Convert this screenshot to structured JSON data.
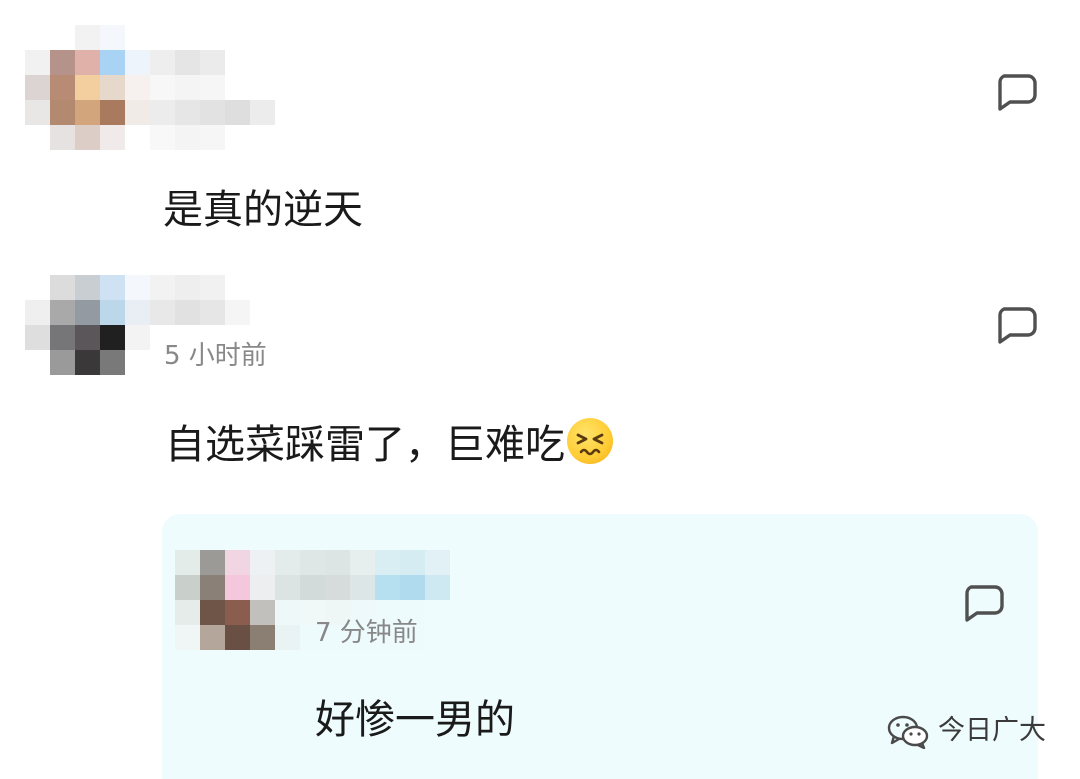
{
  "comments": [
    {
      "text": "是真的逆天",
      "avatar_blur_colors": [
        [
          "#ffffff",
          "#ffffff",
          "#f2f2f2",
          "#f4f8fc",
          "#ffffff",
          "#ffffff",
          "#ffffff",
          "#ffffff",
          "#ffffff",
          "#ffffff",
          "#ffffff"
        ],
        [
          "#f1f1f1",
          "#b5928a",
          "#e0b1a8",
          "#a8d3f5",
          "#eef4fb",
          "#eeeeee",
          "#e5e5e5",
          "#ebebeb",
          "#ffffff",
          "#ffffff",
          "#ffffff"
        ],
        [
          "#dbd4d2",
          "#b78b74",
          "#f3cf9f",
          "#e6d9cc",
          "#f6f1ee",
          "#f7f7f7",
          "#f4f4f4",
          "#f6f6f6",
          "#ffffff",
          "#ffffff",
          "#ffffff"
        ],
        [
          "#e9e6e6",
          "#b3896f",
          "#d3a57d",
          "#a97a5e",
          "#f1ebe8",
          "#ececec",
          "#e6e6e6",
          "#e2e2e2",
          "#dedede",
          "#ececec",
          "#ffffff"
        ],
        [
          "#ffffff",
          "#e6e2e2",
          "#ddcdc7",
          "#f0ebea",
          "#ffffff",
          "#f8f8f8",
          "#f4f4f4",
          "#f6f6f6",
          "#ffffff",
          "#ffffff",
          "#ffffff"
        ]
      ],
      "reply_icon": "comment-bubble-icon"
    },
    {
      "timestamp": "5 小时前",
      "text": "自选菜踩雷了，巨难吃",
      "emoji": "persevering-face-emoji",
      "avatar_blur_colors": [
        [
          "#ffffff",
          "#dcdcdc",
          "#c9ced3",
          "#cfe2f3",
          "#f4f8fc",
          "#f2f2f2",
          "#eeeeee",
          "#f1f1f1",
          "#ffffff",
          "#ffffff",
          "#ffffff"
        ],
        [
          "#efefef",
          "#a9a9aa",
          "#949aa1",
          "#bcd6ea",
          "#e8eef4",
          "#e8e8e8",
          "#e1e1e1",
          "#e6e6e6",
          "#f5f5f5",
          "#ffffff",
          "#ffffff"
        ],
        [
          "#dedede",
          "#767577",
          "#5a565a",
          "#202020",
          "#f3f3f3",
          "#ffffff",
          "#ffffff",
          "#ffffff",
          "#ffffff",
          "#ffffff",
          "#ffffff"
        ],
        [
          "#ffffff",
          "#9b9a9b",
          "#3b3839",
          "#7a797a",
          "#ffffff",
          "#ffffff",
          "#ffffff",
          "#ffffff",
          "#ffffff",
          "#ffffff",
          "#ffffff"
        ]
      ],
      "reply_icon": "comment-bubble-icon"
    }
  ],
  "reply": {
    "timestamp": "7 分钟前",
    "text": "好惨一男的",
    "avatar_blur_colors": [
      [
        "#e3ece9",
        "#9c9a96",
        "#f2d5e3",
        "#eef1f3",
        "#e4eceb",
        "#dfe6e6",
        "#dde4e4",
        "#e7eeee",
        "#d8eef3",
        "#d5ecf2",
        "#e1f1f5"
      ],
      [
        "#c9cfcb",
        "#8a8078",
        "#f5c7dc",
        "#edeef0",
        "#dce3e3",
        "#d3dada",
        "#d6dcdc",
        "#dde6e6",
        "#b6dff0",
        "#b0dbee",
        "#cfe9f3"
      ],
      [
        "#e6ecea",
        "#6e5548",
        "#8a5d4e",
        "#c2c0bc",
        "#eef8f8",
        "#f0f8f8",
        "#eef6f6",
        "#eef9fb",
        "#eefbfc",
        "#eefbfc",
        "#eefcfd"
      ],
      [
        "#f0f6f5",
        "#b4a69b",
        "#6a4f44",
        "#8b7e73",
        "#e9f3f3",
        "#eefbfc",
        "#eefbfc",
        "#eefbfc",
        "#eefbfc",
        "#eefbfc",
        "#eefcfd"
      ]
    ],
    "reply_icon": "comment-bubble-icon"
  },
  "watermark": {
    "icon": "wechat-logo",
    "text": "今日广大"
  },
  "colors": {
    "text": "#1a1a1a",
    "timestamp": "#888888",
    "reply_panel": "#eefcfd",
    "icon_stroke": "#505050"
  }
}
